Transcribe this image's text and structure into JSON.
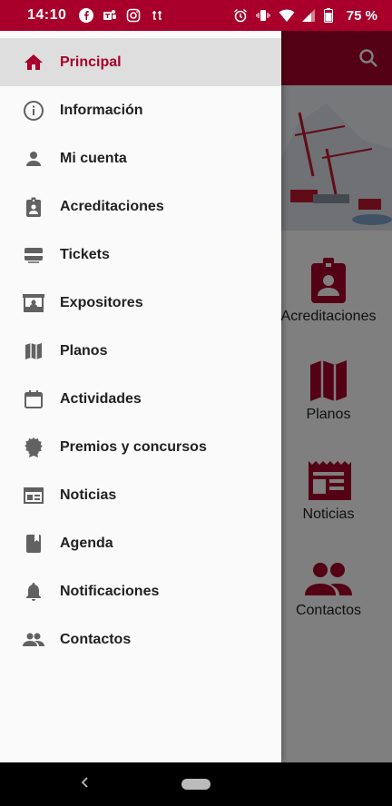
{
  "status": {
    "time": "14:10",
    "battery": "75 %"
  },
  "background_app": {
    "grid": [
      {
        "label": "Acreditaciones",
        "icon": "badge-icon"
      },
      {
        "label": "Planos",
        "icon": "map-icon"
      },
      {
        "label": "Noticias",
        "icon": "news-icon"
      },
      {
        "label": "Contactos",
        "icon": "people-icon"
      }
    ]
  },
  "drawer": {
    "items": [
      {
        "label": "Principal",
        "icon": "home-icon",
        "active": true
      },
      {
        "label": "Información",
        "icon": "info-icon"
      },
      {
        "label": "Mi cuenta",
        "icon": "person-icon"
      },
      {
        "label": "Acreditaciones",
        "icon": "badge-icon"
      },
      {
        "label": "Tickets",
        "icon": "ticket-icon"
      },
      {
        "label": "Expositores",
        "icon": "booth-icon"
      },
      {
        "label": "Planos",
        "icon": "map-icon"
      },
      {
        "label": "Actividades",
        "icon": "calendar-icon"
      },
      {
        "label": "Premios y concursos",
        "icon": "award-icon"
      },
      {
        "label": "Noticias",
        "icon": "news-icon"
      },
      {
        "label": "Agenda",
        "icon": "book-icon"
      },
      {
        "label": "Notificaciones",
        "icon": "bell-icon"
      },
      {
        "label": "Contactos",
        "icon": "people-icon"
      }
    ]
  },
  "colors": {
    "brand": "#a8002a",
    "icon_gray": "#616161",
    "active_bg": "#dedede"
  }
}
